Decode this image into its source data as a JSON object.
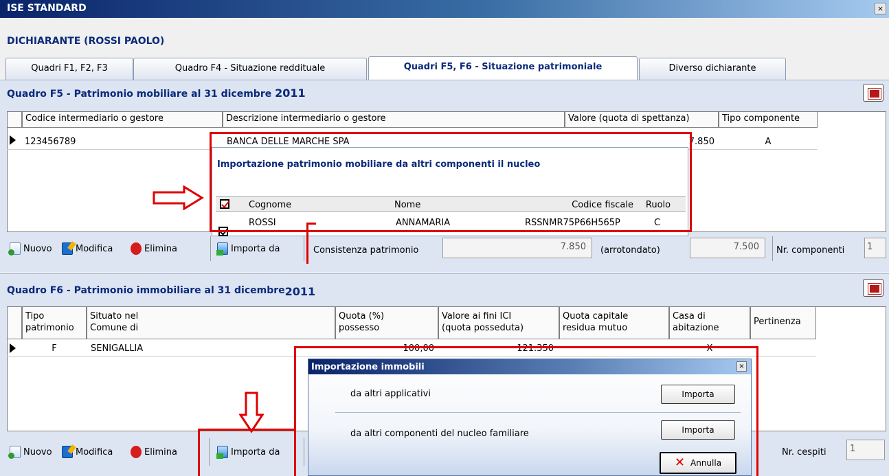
{
  "window": {
    "title": "ISE STANDARD",
    "close": "×"
  },
  "header": {
    "dichiarante": "DICHIARANTE (ROSSI PAOLO)"
  },
  "tabs": [
    {
      "label": "Quadri F1, F2, F3"
    },
    {
      "label": "Quadro F4 - Situazione reddituale"
    },
    {
      "label": "Quadri F5, F6 - Situazione patrimoniale"
    },
    {
      "label": "Diverso dichiarante"
    }
  ],
  "f5": {
    "title": "Quadro F5 - Patrimonio mobiliare al 31 dicembre",
    "year": "2011",
    "columns": [
      "Codice intermediario o gestore",
      "Descrizione intermediario o gestore",
      "Valore (quota di spettanza)",
      "Tipo componente"
    ],
    "row": {
      "codice": "123456789",
      "descrizione": "BANCA DELLE MARCHE SPA",
      "valore": "7.850",
      "tipo": "A"
    },
    "toolbar": {
      "nuovo": "Nuovo",
      "modifica": "Modifica",
      "elimina": "Elimina",
      "importa": "Importa da"
    },
    "consistenza_label": "Consistenza patrimonio",
    "consistenza_value": "7.850",
    "arrotondato_label": "(arrotondato)",
    "arrotondato_value": "7.500",
    "nr_componenti_label": "Nr. componenti",
    "nr_componenti_value": "1"
  },
  "import_popup": {
    "title": "Importazione patrimonio mobiliare da altri componenti il nucleo",
    "columns": [
      "Cognome",
      "Nome",
      "Codice fiscale",
      "Ruolo"
    ],
    "row": {
      "cognome": "ROSSI",
      "nome": "ANNAMARIA",
      "cf": "RSSNMR75P66H565P",
      "ruolo": "C"
    }
  },
  "f6": {
    "title": "Quadro F6 - Patrimonio immobiliare al 31 dicembre",
    "year": "2011",
    "columns": [
      {
        "l1": "Tipo",
        "l2": "patrimonio"
      },
      {
        "l1": "Situato nel",
        "l2": "Comune di"
      },
      {
        "l1": "Quota (%)",
        "l2": "possesso"
      },
      {
        "l1": "Valore ai fini ICI",
        "l2": "(quota posseduta)"
      },
      {
        "l1": "Quota capitale",
        "l2": "residua mutuo"
      },
      {
        "l1": "Casa di",
        "l2": "abitazione"
      },
      {
        "l1": "Pertinenza",
        "l2": ""
      }
    ],
    "row": {
      "tipo": "F",
      "comune": "SENIGALLIA",
      "quota": "100,00",
      "valore": "121.350",
      "abitazione": "X"
    },
    "toolbar": {
      "nuovo": "Nuovo",
      "modifica": "Modifica",
      "elimina": "Elimina",
      "importa": "Importa da"
    },
    "nr_cespiti_label": "Nr. cespiti",
    "nr_cespiti_value": "1"
  },
  "dialog": {
    "title": "Importazione immobili",
    "close": "×",
    "opt1": "da altri applicativi",
    "opt2": "da altri componenti del nucleo familiare",
    "importa": "Importa",
    "annulla": "Annulla"
  },
  "colors": {
    "header_text": "#0a2a7a",
    "annotation_red": "#e00000"
  }
}
